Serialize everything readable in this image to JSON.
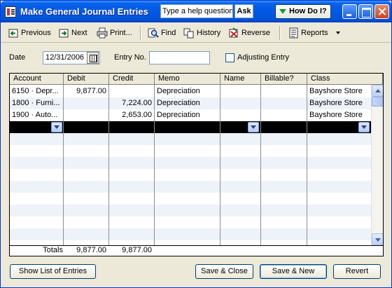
{
  "window": {
    "title": "Make General Journal Entries"
  },
  "help": {
    "placeholder": "Type a help question",
    "ask_label": "Ask",
    "howdoi_label": "How Do I?"
  },
  "toolbar": {
    "previous": "Previous",
    "next": "Next",
    "print": "Print...",
    "find": "Find",
    "history": "History",
    "reverse": "Reverse",
    "reports": "Reports"
  },
  "header": {
    "date_label": "Date",
    "date_value": "12/31/2006",
    "entry_no_label": "Entry No.",
    "entry_no_value": "",
    "adjusting_label": "Adjusting Entry",
    "adjusting_checked": false
  },
  "grid": {
    "columns": [
      "Account",
      "Debit",
      "Credit",
      "Memo",
      "Name",
      "Billable?",
      "Class"
    ],
    "rows": [
      {
        "account": "6150 · Depr...",
        "debit": "9,877.00",
        "credit": "",
        "memo": "Depreciation",
        "name": "",
        "billable": "",
        "class": "Bayshore Store"
      },
      {
        "account": "1800 · Furni...",
        "debit": "",
        "credit": "7,224.00",
        "memo": "Depreciation",
        "name": "",
        "billable": "",
        "class": "Bayshore Store"
      },
      {
        "account": "1900 · Auto...",
        "debit": "",
        "credit": "2,653.00",
        "memo": "Depreciation",
        "name": "",
        "billable": "",
        "class": "Bayshore Store"
      }
    ],
    "totals": {
      "label": "Totals",
      "debit": "9,877.00",
      "credit": "9,877.00"
    }
  },
  "buttons": {
    "show_list": "Show List of Entries",
    "save_close": "Save & Close",
    "save_new": "Save & New",
    "revert": "Revert"
  },
  "icons": {
    "previous": "arrow-left-icon",
    "next": "arrow-right-icon",
    "print": "printer-icon",
    "find": "find-icon",
    "history": "history-icon",
    "reverse": "reverse-icon",
    "reports": "reports-icon"
  },
  "colors": {
    "titlebar": "#0054d8",
    "selected_row": "#000000",
    "alt_row": "#eef2f9"
  }
}
